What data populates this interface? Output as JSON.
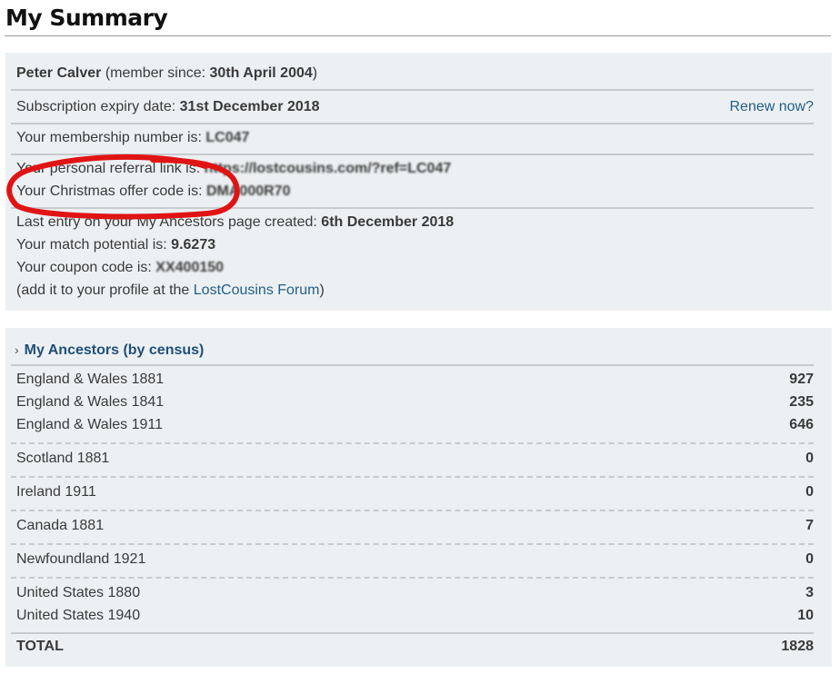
{
  "page": {
    "title": "My Summary"
  },
  "summary": {
    "member_name": "Peter Calver",
    "member_since_prefix": " (member since: ",
    "member_since_date": "30th April 2004",
    "member_since_suffix": ")",
    "expiry_label": "Subscription expiry date: ",
    "expiry_date": "31st December 2018",
    "renew_link": "Renew now?",
    "membership_label": "Your membership number is: ",
    "membership_value": "LC047",
    "referral_label": "Your personal referral link is: ",
    "referral_value": "https://lostcousins.com/?ref=LC047",
    "christmas_label": "Your Christmas offer code is: ",
    "christmas_value": "DMA000R70",
    "last_entry_label": "Last entry on your My Ancestors page created: ",
    "last_entry_value": "6th December 2018",
    "match_label": "Your match potential is: ",
    "match_value": "9.6273",
    "coupon_label": "Your coupon code is: ",
    "coupon_value": "XX400150",
    "forum_prefix": "(add it to your profile at the ",
    "forum_link": "LostCousins Forum",
    "forum_suffix": ")"
  },
  "ancestors": {
    "chevron": "›",
    "heading": "My Ancestors (by census)",
    "rows": [
      {
        "census": "England & Wales 1881",
        "count": "927"
      },
      {
        "census": "England & Wales 1841",
        "count": "235"
      },
      {
        "census": "England & Wales 1911",
        "count": "646"
      },
      {
        "census": "Scotland 1881",
        "count": "0"
      },
      {
        "census": "Ireland 1911",
        "count": "0"
      },
      {
        "census": "Canada 1881",
        "count": "7"
      },
      {
        "census": "Newfoundland 1921",
        "count": "0"
      },
      {
        "census": "United States 1880",
        "count": "3"
      },
      {
        "census": "United States 1940",
        "count": "10"
      }
    ],
    "total_label": "TOTAL",
    "total_value": "1828"
  },
  "colors": {
    "link": "#1f5f8a",
    "panel": "#edf0f2",
    "annotation": "#e01414"
  }
}
